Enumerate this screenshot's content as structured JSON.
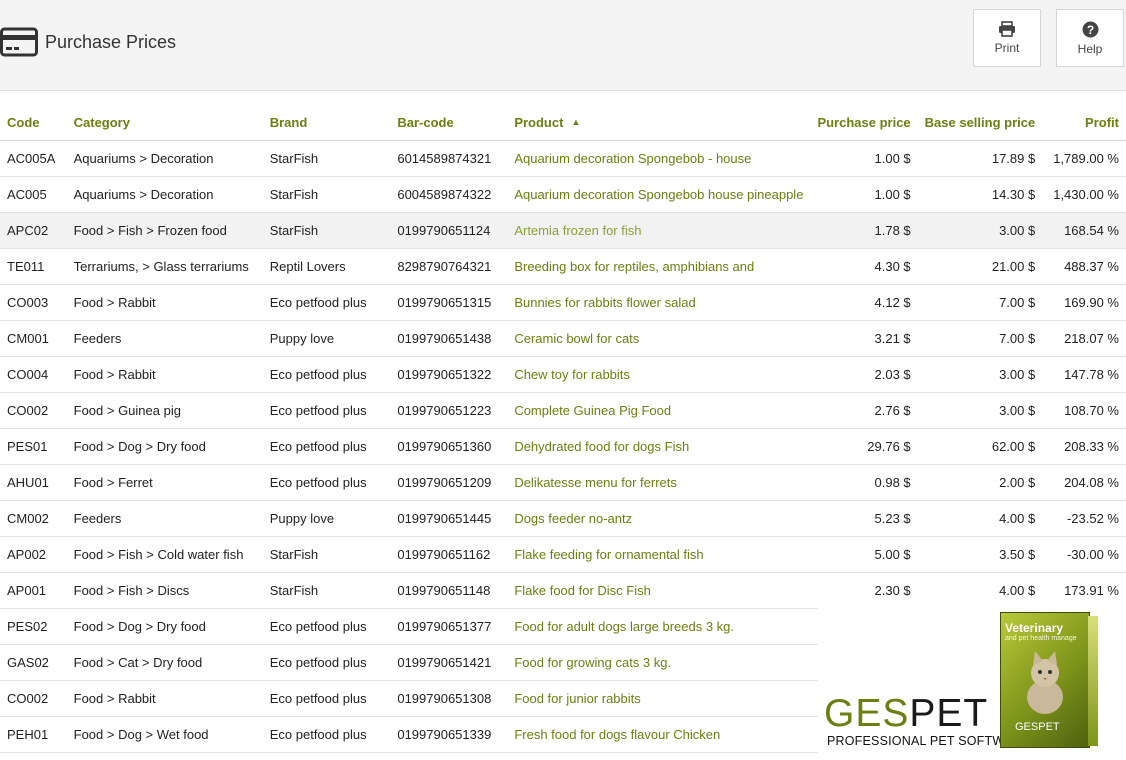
{
  "header": {
    "title": "Purchase Prices",
    "print_label": "Print",
    "help_label": "Help",
    "title_icon": "credit-card-icon"
  },
  "table": {
    "columns": [
      "Code",
      "Category",
      "Brand",
      "Bar-code",
      "Product",
      "Purchase price",
      "Base selling price",
      "Profit"
    ],
    "sort_column": "Product",
    "sort_direction": "ascending",
    "rows": [
      [
        "AC005A",
        "Aquariums > Decoration",
        "StarFish",
        "6014589874321",
        "Aquarium decoration Spongebob - house",
        "1.00 $",
        "17.89 $",
        "1,789.00 %"
      ],
      [
        "AC005",
        "Aquariums > Decoration",
        "StarFish",
        "6004589874322",
        "Aquarium decoration Spongebob house pineapple",
        "1.00 $",
        "14.30 $",
        "1,430.00 %"
      ],
      [
        "APC02",
        "Food > Fish > Frozen food",
        "StarFish",
        "0199790651124",
        "Artemia frozen for fish",
        "1.78 $",
        "3.00 $",
        "168.54 %"
      ],
      [
        "TE011",
        "Terrariums, > Glass terrariums",
        "Reptil Lovers",
        "8298790764321",
        "Breeding box for reptiles, amphibians and",
        "4.30 $",
        "21.00 $",
        "488.37 %"
      ],
      [
        "CO003",
        "Food > Rabbit",
        "Eco petfood plus",
        "0199790651315",
        "Bunnies for rabbits flower salad",
        "4.12 $",
        "7.00 $",
        "169.90 %"
      ],
      [
        "CM001",
        "Feeders",
        "Puppy love",
        "0199790651438",
        "Ceramic bowl for cats",
        "3.21 $",
        "7.00 $",
        "218.07 %"
      ],
      [
        "CO004",
        "Food > Rabbit",
        "Eco petfood plus",
        "0199790651322",
        "Chew toy for rabbits",
        "2.03 $",
        "3.00 $",
        "147.78 %"
      ],
      [
        "CO002",
        "Food > Guinea pig",
        "Eco petfood plus",
        "0199790651223",
        "Complete Guinea Pig Food",
        "2.76 $",
        "3.00 $",
        "108.70 %"
      ],
      [
        "PES01",
        "Food > Dog > Dry food",
        "Eco petfood plus",
        "0199790651360",
        "Dehydrated food for dogs Fish",
        "29.76 $",
        "62.00 $",
        "208.33 %"
      ],
      [
        "AHU01",
        "Food > Ferret",
        "Eco petfood plus",
        "0199790651209",
        "Delikatesse menu for ferrets",
        "0.98 $",
        "2.00 $",
        "204.08 %"
      ],
      [
        "CM002",
        "Feeders",
        "Puppy love",
        "0199790651445",
        "Dogs feeder no-antz",
        "5.23 $",
        "4.00 $",
        "-23.52 %"
      ],
      [
        "AP002",
        "Food > Fish > Cold water fish",
        "StarFish",
        "0199790651162",
        "Flake feeding for ornamental fish",
        "5.00 $",
        "3.50 $",
        "-30.00 %"
      ],
      [
        "AP001",
        "Food > Fish > Discs",
        "StarFish",
        "0199790651148",
        "Flake food for Disc Fish",
        "2.30 $",
        "4.00 $",
        "173.91 %"
      ],
      [
        "PES02",
        "Food > Dog > Dry food",
        "Eco petfood plus",
        "0199790651377",
        "Food for adult dogs large breeds 3 kg.",
        "",
        "",
        ""
      ],
      [
        "GAS02",
        "Food > Cat > Dry food",
        "Eco petfood plus",
        "0199790651421",
        "Food for growing cats 3 kg.",
        "",
        "",
        ""
      ],
      [
        "CO002",
        "Food > Rabbit",
        "Eco petfood plus",
        "0199790651308",
        "Food for junior rabbits",
        "",
        "",
        ""
      ],
      [
        "PEH01",
        "Food > Dog > Wet food",
        "Eco petfood plus",
        "0199790651339",
        "Fresh food for dogs flavour Chicken",
        "",
        "",
        ""
      ]
    ]
  },
  "logo": {
    "brand_ges": "GES",
    "brand_pet": "PET",
    "tagline": "PROFESSIONAL PET SOFTWARE",
    "box_title": "Veterinary",
    "box_subtitle": "and pet health manage",
    "box_brand": "GESPET"
  }
}
